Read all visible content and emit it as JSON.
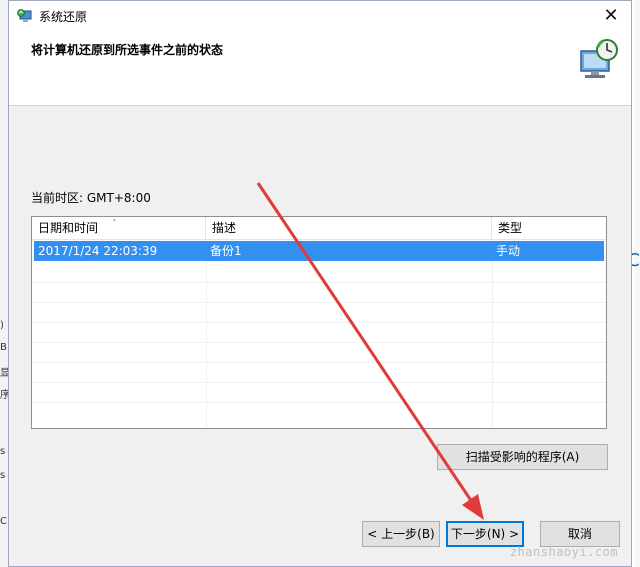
{
  "background": {
    "left_fragments": [
      ")",
      "B",
      "显",
      "序",
      "s",
      "s",
      "C"
    ],
    "right_fragment": "C"
  },
  "window": {
    "title": "系统还原",
    "close_symbol": "✕"
  },
  "header": {
    "instruction": "将计算机还原到所选事件之前的状态"
  },
  "timezone_label": "当前时区: GMT+8:00",
  "list": {
    "columns": [
      "日期和时间",
      "描述",
      "类型"
    ],
    "sort_indicator": "˅",
    "rows": [
      {
        "date": "2017/1/24 22:03:39",
        "description": "备份1",
        "type": "手动",
        "selected": true
      }
    ]
  },
  "buttons": {
    "scan": "扫描受影响的程序(A)",
    "prev": "< 上一步(B)",
    "next": "下一步(N) >",
    "cancel": "取消"
  },
  "watermark": "zhanshaoyi.com",
  "colors": {
    "accent": "#0078d7",
    "selection": "#3390f0",
    "annotation_arrow": "#e03a3a"
  }
}
